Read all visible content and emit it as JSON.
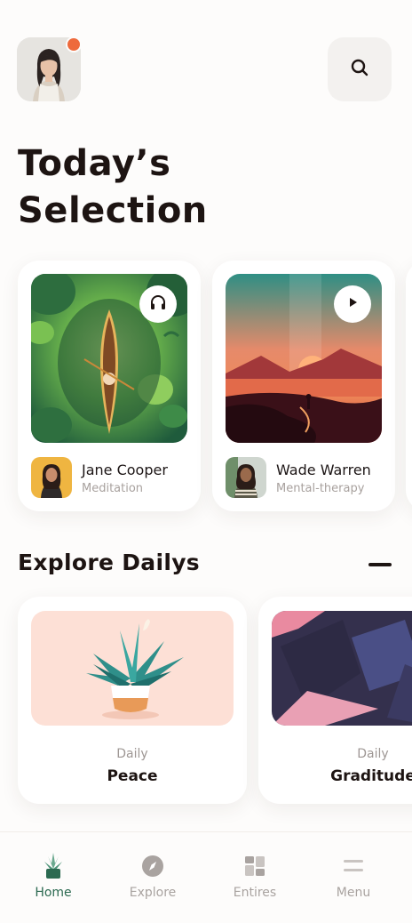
{
  "header": {
    "title_line1": "Today’s",
    "title_line2": "Selection",
    "profile_icon": "user-avatar",
    "search_icon": "search-icon",
    "notification_color": "#ee6a3c"
  },
  "selection": [
    {
      "author": "Jane Cooper",
      "category": "Meditation",
      "action_icon": "headphones-icon"
    },
    {
      "author": "Wade Warren",
      "category": "Mental-therapy",
      "action_icon": "play-icon"
    }
  ],
  "explore": {
    "title": "Explore Dailys",
    "items": [
      {
        "label": "Daily",
        "name": "Peace"
      },
      {
        "label": "Daily",
        "name": "Graditude"
      }
    ]
  },
  "nav": {
    "items": [
      {
        "label": "Home",
        "icon": "plant-icon",
        "active": true
      },
      {
        "label": "Explore",
        "icon": "compass-icon",
        "active": false
      },
      {
        "label": "Entires",
        "icon": "dashboard-icon",
        "active": false
      },
      {
        "label": "Menu",
        "icon": "menu-icon",
        "active": false
      }
    ],
    "active_color": "#2c6a51"
  }
}
